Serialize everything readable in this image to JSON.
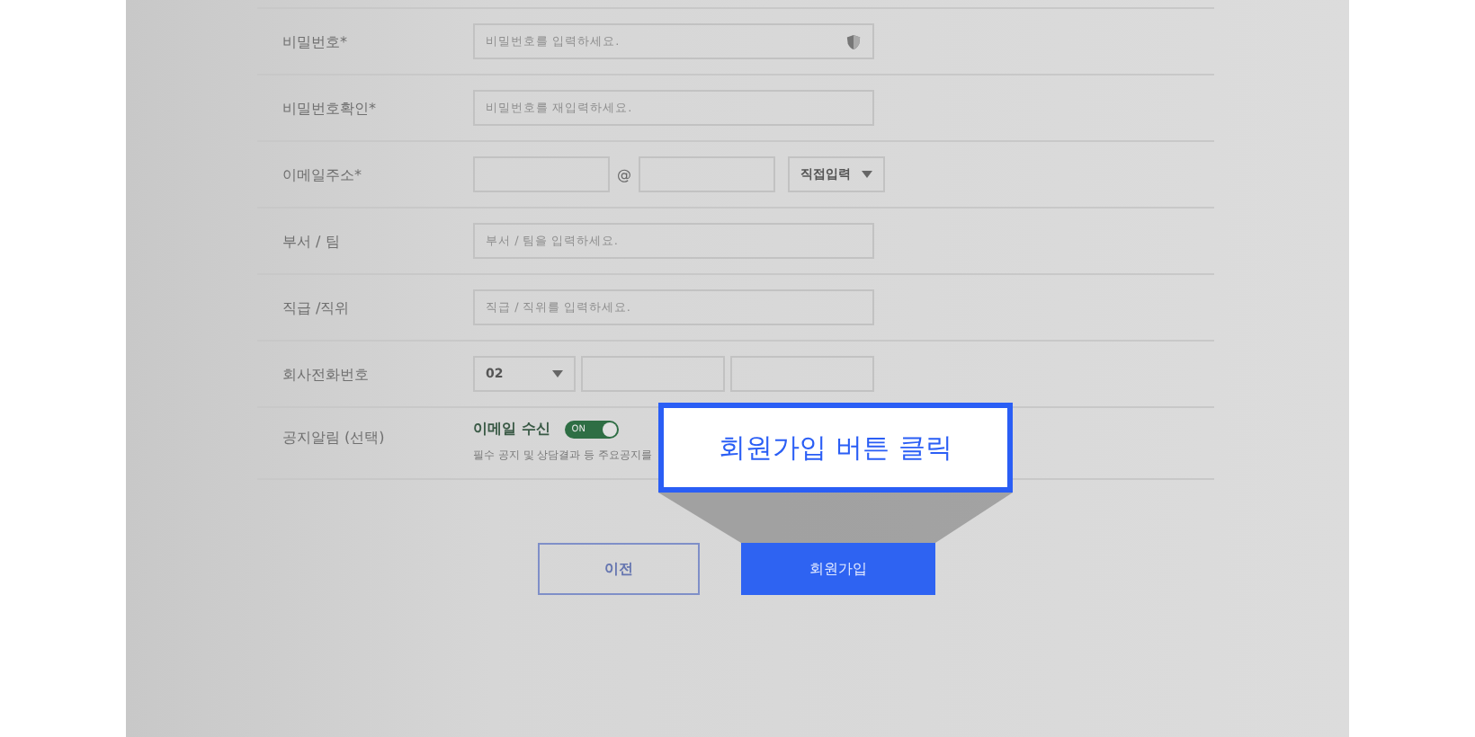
{
  "fields": [
    {
      "kind": "password",
      "label": "비밀번호*",
      "placeholder": "비밀번호를 입력하세요."
    },
    {
      "kind": "text",
      "label": "비밀번호확인*",
      "placeholder": "비밀번호를 재입력하세요."
    },
    {
      "kind": "email",
      "label": "이메일주소*",
      "separator": "@",
      "domain_select": "직접입력"
    },
    {
      "kind": "text",
      "label": "부서 / 팀",
      "placeholder": "부서 / 팀을 입력하세요."
    },
    {
      "kind": "text",
      "label": "직급 /직위",
      "placeholder": "직급 / 직위를 입력하세요."
    },
    {
      "kind": "phone",
      "label": "회사전화번호",
      "area_code": "02"
    },
    {
      "kind": "toggle",
      "label": "공지알림 (선택)",
      "toggle_label": "이메일 수신",
      "on": true,
      "toggle_text": "ON",
      "note": "필수 공지 및 상담결과 등 주요공지를"
    }
  ],
  "buttons": [
    {
      "kind": "secondary",
      "label": "이전"
    },
    {
      "kind": "primary",
      "label": "회원가입"
    }
  ],
  "callout": {
    "text": "회원가입 버튼 클릭"
  }
}
